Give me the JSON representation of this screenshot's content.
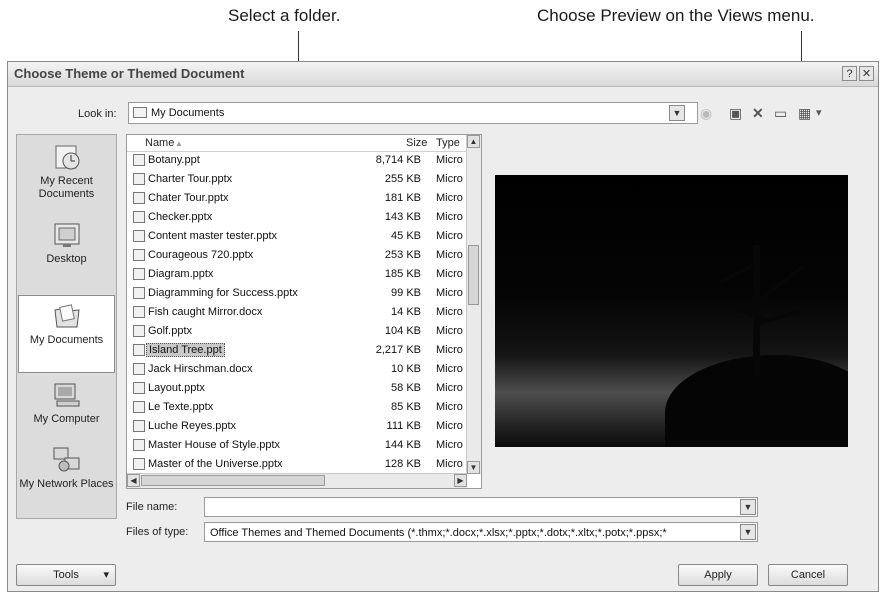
{
  "callouts": {
    "folder": "Select a folder.",
    "preview": "Choose Preview on the Views menu."
  },
  "window": {
    "title": "Choose Theme or Themed Document",
    "help_glyph": "?",
    "close_glyph": "✕"
  },
  "lookin": {
    "label": "Look in:",
    "value": "My Documents",
    "dropdown_glyph": "▼"
  },
  "toolbar": {
    "back_glyph": "◉",
    "up_glyph": "▣",
    "delete_glyph": "✕",
    "newfolder_glyph": "▭",
    "views_glyph": "▦",
    "views_arrow": "▾"
  },
  "places": [
    {
      "label": "My Recent Documents",
      "icon": "recent-documents-icon"
    },
    {
      "label": "Desktop",
      "icon": "desktop-icon"
    },
    {
      "label": "My Documents",
      "icon": "my-documents-icon"
    },
    {
      "label": "My Computer",
      "icon": "computer-icon"
    },
    {
      "label": "My Network Places",
      "icon": "network-places-icon"
    }
  ],
  "filelist": {
    "headers": {
      "name": "Name",
      "size": "Size",
      "type": "Type"
    },
    "files": [
      {
        "name": "Botany.ppt",
        "size": "8,714 KB",
        "type": "Micro"
      },
      {
        "name": "Charter Tour.pptx",
        "size": "255 KB",
        "type": "Micro"
      },
      {
        "name": "Chater Tour.pptx",
        "size": "181 KB",
        "type": "Micro"
      },
      {
        "name": "Checker.pptx",
        "size": "143 KB",
        "type": "Micro"
      },
      {
        "name": "Content master tester.pptx",
        "size": "45 KB",
        "type": "Micro"
      },
      {
        "name": "Courageous 720.pptx",
        "size": "253 KB",
        "type": "Micro"
      },
      {
        "name": "Diagram.pptx",
        "size": "185 KB",
        "type": "Micro"
      },
      {
        "name": "Diagramming for Success.pptx",
        "size": "99 KB",
        "type": "Micro"
      },
      {
        "name": "Fish caught Mirror.docx",
        "size": "14 KB",
        "type": "Micro"
      },
      {
        "name": "Golf.pptx",
        "size": "104 KB",
        "type": "Micro"
      },
      {
        "name": "Island Tree.ppt",
        "size": "2,217 KB",
        "type": "Micro"
      },
      {
        "name": "Jack Hirschman.docx",
        "size": "10 KB",
        "type": "Micro"
      },
      {
        "name": "Layout.pptx",
        "size": "58 KB",
        "type": "Micro"
      },
      {
        "name": "Le Texte.pptx",
        "size": "85 KB",
        "type": "Micro"
      },
      {
        "name": "Luche Reyes.pptx",
        "size": "111 KB",
        "type": "Micro"
      },
      {
        "name": "Master House of Style.pptx",
        "size": "144 KB",
        "type": "Micro"
      },
      {
        "name": "Master of the Universe.pptx",
        "size": "128 KB",
        "type": "Micro"
      }
    ],
    "selected_index": 10
  },
  "filename": {
    "label": "File name:",
    "value": ""
  },
  "filetype": {
    "label": "Files of type:",
    "value": "Office Themes and Themed Documents (*.thmx;*.docx;*.xlsx;*.pptx;*.dotx;*.xltx;*.potx;*.ppsx;*"
  },
  "buttons": {
    "tools": "Tools",
    "tools_arrow": "▾",
    "apply": "Apply",
    "cancel": "Cancel"
  }
}
